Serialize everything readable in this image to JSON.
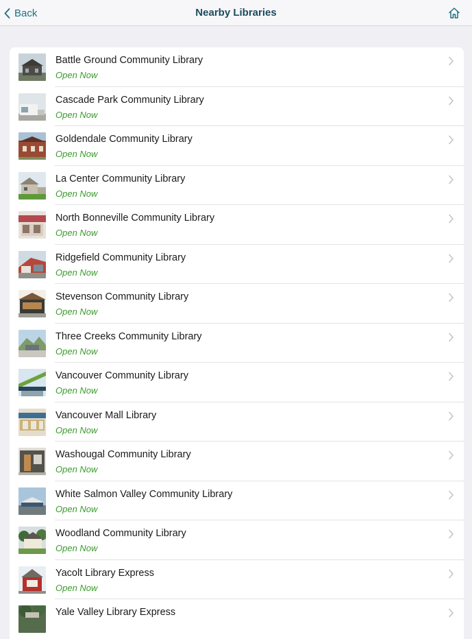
{
  "navbar": {
    "back_label": "Back",
    "title": "Nearby Libraries",
    "accent_color": "#1f6f82"
  },
  "libraries": [
    {
      "name": "Battle Ground Community Library",
      "status": "Open Now"
    },
    {
      "name": "Cascade Park Community Library",
      "status": "Open Now"
    },
    {
      "name": "Goldendale Community Library",
      "status": "Open Now"
    },
    {
      "name": "La Center Community Library",
      "status": "Open Now"
    },
    {
      "name": "North Bonneville Community Library",
      "status": "Open Now"
    },
    {
      "name": "Ridgefield Community Library",
      "status": "Open Now"
    },
    {
      "name": "Stevenson Community Library",
      "status": "Open Now"
    },
    {
      "name": "Three Creeks Community Library",
      "status": "Open Now"
    },
    {
      "name": "Vancouver Community Library",
      "status": "Open Now"
    },
    {
      "name": "Vancouver Mall Library",
      "status": "Open Now"
    },
    {
      "name": "Washougal Community Library",
      "status": "Open Now"
    },
    {
      "name": "White Salmon Valley Community Library",
      "status": "Open Now"
    },
    {
      "name": "Woodland Community Library",
      "status": "Open Now"
    },
    {
      "name": "Yacolt Library Express",
      "status": "Open Now"
    },
    {
      "name": "Yale Valley Library Express",
      "status": ""
    }
  ],
  "status_color": "#3a9b2c"
}
